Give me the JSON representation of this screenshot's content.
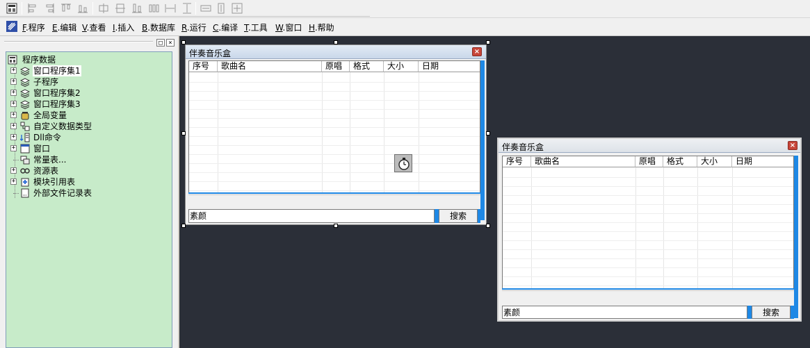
{
  "menu": {
    "items": [
      {
        "key": "F",
        "label": ".程序"
      },
      {
        "key": "E",
        "label": ".编辑"
      },
      {
        "key": "V",
        "label": ".查看"
      },
      {
        "key": "I",
        "label": ".插入"
      },
      {
        "key": "B",
        "label": ".数据库"
      },
      {
        "key": "R",
        "label": ".运行"
      },
      {
        "key": "C",
        "label": ".编译"
      },
      {
        "key": "T",
        "label": ".工具"
      },
      {
        "key": "W",
        "label": ".窗口"
      },
      {
        "key": "H",
        "label": ".帮助"
      }
    ]
  },
  "panel": {
    "restore_glyph": "□",
    "close_glyph": "×"
  },
  "tree": {
    "root": "程序数据",
    "items": [
      {
        "label": "窗口程序集1",
        "icon": "layers-icon",
        "expand": "+"
      },
      {
        "label": "子程序",
        "icon": "layers-icon",
        "expand": "+"
      },
      {
        "label": "窗口程序集2",
        "icon": "layers-icon",
        "expand": "+"
      },
      {
        "label": "窗口程序集3",
        "icon": "layers-icon",
        "expand": "+"
      },
      {
        "label": "全局变量",
        "icon": "jar-icon",
        "expand": "+"
      },
      {
        "label": "自定义数据类型",
        "icon": "datatype-icon",
        "expand": "+"
      },
      {
        "label": "Dll命令",
        "icon": "dll-icon",
        "expand": "+"
      },
      {
        "label": "窗口",
        "icon": "window-icon",
        "expand": "+"
      },
      {
        "label": "常量表...",
        "icon": "constants-icon",
        "expand": ""
      },
      {
        "label": "资源表",
        "icon": "resources-icon",
        "expand": "+"
      },
      {
        "label": "模块引用表",
        "icon": "module-icon",
        "expand": "+"
      },
      {
        "label": "外部文件记录表",
        "icon": "file-icon",
        "expand": ""
      }
    ]
  },
  "form1": {
    "title": "伴奏音乐盒",
    "close_glyph": "×",
    "columns": [
      "序号",
      "歌曲名",
      "原唱",
      "格式",
      "大小",
      "日期"
    ],
    "search_value": "素颜",
    "search_button": "搜索"
  },
  "form2": {
    "title": "伴奏音乐盒",
    "close_glyph": "×",
    "columns": [
      "序号",
      "歌曲名",
      "原唱",
      "格式",
      "大小",
      "日期"
    ],
    "search_value": "素颜",
    "search_button": "搜索"
  },
  "colors": {
    "tree_background": "#c7ebc9",
    "accent_blue": "#1e88e5",
    "design_background": "#2b2f38"
  }
}
